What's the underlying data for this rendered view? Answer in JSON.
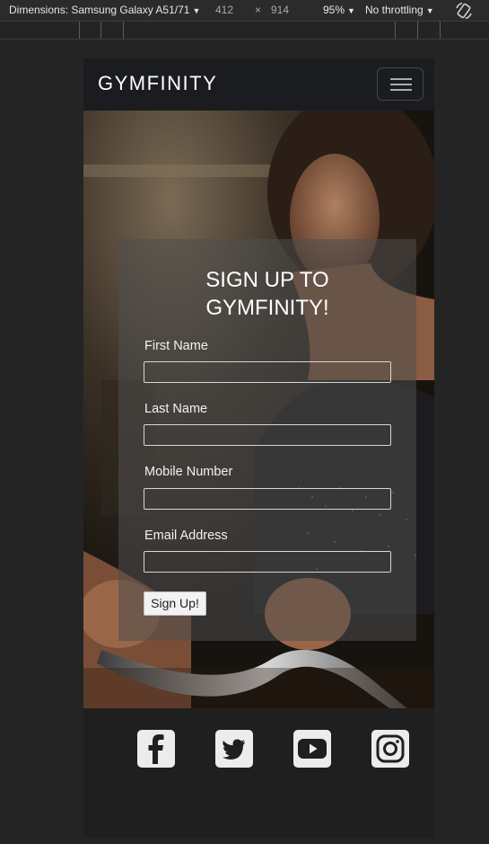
{
  "devtools": {
    "dimensions_label": "Dimensions: Samsung Galaxy A51/71",
    "width": "412",
    "times": "×",
    "height": "914",
    "zoom": "95%",
    "throttling": "No throttling"
  },
  "navbar": {
    "brand": "GYMFINITY",
    "toggler_icon": "hamburger-icon"
  },
  "form": {
    "title_line1": "SIGN UP TO",
    "title_line2": "GYMFINITY!",
    "fields": [
      {
        "label": "First Name",
        "value": ""
      },
      {
        "label": "Last Name",
        "value": ""
      },
      {
        "label": "Mobile Number",
        "value": ""
      },
      {
        "label": "Email Address",
        "value": ""
      }
    ],
    "submit_label": "Sign Up!"
  },
  "footer": {
    "social_icons": [
      "facebook-icon",
      "twitter-icon",
      "youtube-icon",
      "instagram-icon"
    ]
  },
  "colors": {
    "navbar_bg": "#1a1c20",
    "card_bg": "rgba(78,78,78,0.55)",
    "footer_bg": "#1f1f1f",
    "icon_bg": "#ececec"
  }
}
